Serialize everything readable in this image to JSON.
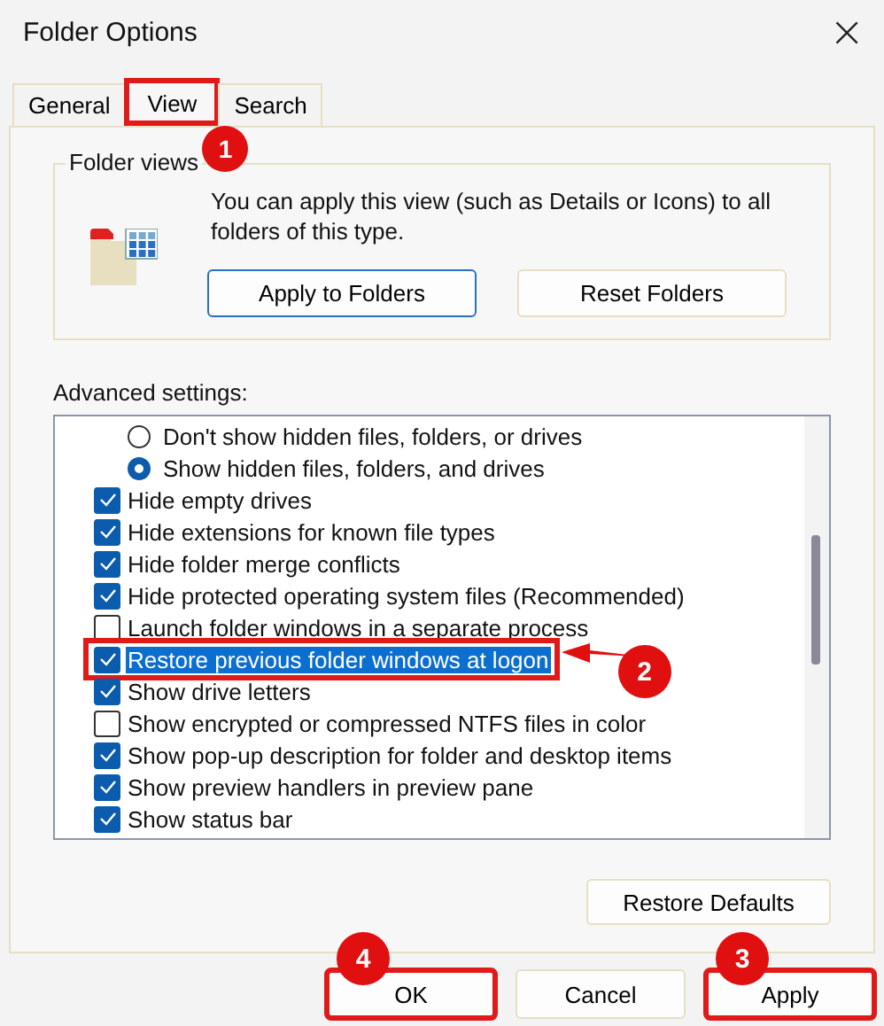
{
  "window": {
    "title": "Folder Options",
    "close": "×"
  },
  "tabs": [
    {
      "label": "General",
      "selected": false,
      "highlighted": false
    },
    {
      "label": "View",
      "selected": true,
      "highlighted": true,
      "callout": "1"
    },
    {
      "label": "Search",
      "selected": false,
      "highlighted": false
    }
  ],
  "folder_views": {
    "title": "Folder views",
    "description": "You can apply this view (such as Details or Icons) to all folders of this type.",
    "buttons": [
      {
        "label": "Apply to Folders",
        "focused": true
      },
      {
        "label": "Reset Folders",
        "focused": false
      }
    ]
  },
  "advanced": {
    "label": "Advanced settings:",
    "items": [
      {
        "kind": "radio",
        "label": "Don't show hidden files, folders, or drives",
        "checked": false,
        "selected": false,
        "highlighted": false
      },
      {
        "kind": "radio",
        "label": "Show hidden files, folders, and drives",
        "checked": true,
        "selected": false,
        "highlighted": false
      },
      {
        "kind": "checkbox",
        "label": "Hide empty drives",
        "checked": true,
        "selected": false,
        "highlighted": false
      },
      {
        "kind": "checkbox",
        "label": "Hide extensions for known file types",
        "checked": true,
        "selected": false,
        "highlighted": false
      },
      {
        "kind": "checkbox",
        "label": "Hide folder merge conflicts",
        "checked": true,
        "selected": false,
        "highlighted": false
      },
      {
        "kind": "checkbox",
        "label": "Hide protected operating system files (Recommended)",
        "checked": true,
        "selected": false,
        "highlighted": false
      },
      {
        "kind": "checkbox",
        "label": "Launch folder windows in a separate process",
        "checked": false,
        "selected": false,
        "highlighted": false
      },
      {
        "kind": "checkbox",
        "label": "Restore previous folder windows at logon",
        "checked": true,
        "selected": true,
        "highlighted": true,
        "callout": "2"
      },
      {
        "kind": "checkbox",
        "label": "Show drive letters",
        "checked": true,
        "selected": false,
        "highlighted": false
      },
      {
        "kind": "checkbox",
        "label": "Show encrypted or compressed NTFS files in color",
        "checked": false,
        "selected": false,
        "highlighted": false
      },
      {
        "kind": "checkbox",
        "label": "Show pop-up description for folder and desktop items",
        "checked": true,
        "selected": false,
        "highlighted": false
      },
      {
        "kind": "checkbox",
        "label": "Show preview handlers in preview pane",
        "checked": true,
        "selected": false,
        "highlighted": false
      },
      {
        "kind": "checkbox",
        "label": "Show status bar",
        "checked": true,
        "selected": false,
        "highlighted": false
      }
    ],
    "restore_button": "Restore Defaults"
  },
  "buttons": [
    {
      "label": "OK",
      "highlighted": true,
      "callout": "4"
    },
    {
      "label": "Cancel",
      "highlighted": false
    },
    {
      "label": "Apply",
      "highlighted": true,
      "callout": "3"
    }
  ]
}
